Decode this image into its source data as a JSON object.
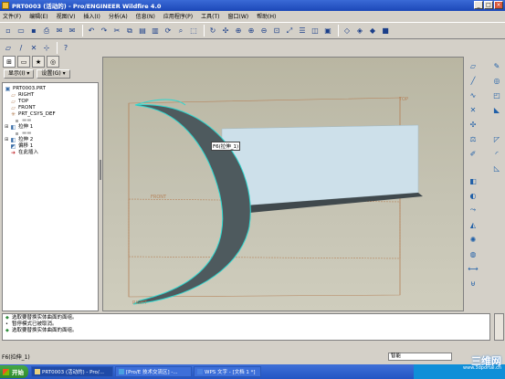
{
  "window": {
    "title": "PRT0003 (活动的) - Pro/ENGINEER Wildfire 4.0"
  },
  "menu": [
    "文件(F)",
    "编辑(E)",
    "视图(V)",
    "插入(I)",
    "分析(A)",
    "信息(N)",
    "应用程序(P)",
    "工具(T)",
    "窗口(W)",
    "帮助(H)"
  ],
  "panel": {
    "show_label": "显示(I) ▾",
    "settings_label": "设置(G) ▾"
  },
  "tree": {
    "root": "PRT0003.PRT",
    "items": [
      {
        "label": "RIGHT",
        "icon": "datum-plane-icon"
      },
      {
        "label": "TOP",
        "icon": "datum-plane-icon"
      },
      {
        "label": "FRONT",
        "icon": "datum-plane-icon"
      },
      {
        "label": "PRT_CSYS_DEF",
        "icon": "csys-icon"
      },
      {
        "label": "拉伸 1",
        "icon": "extrude-icon"
      },
      {
        "label": "拉伸 2",
        "icon": "extrude-icon"
      },
      {
        "label": "偏移 1",
        "icon": "offset-icon"
      },
      {
        "label": "在此插入",
        "icon": "insert-here-icon"
      }
    ]
  },
  "viewport": {
    "tooltip": "F6(拉伸_1)",
    "labels": {
      "top": "TOP",
      "front": "FRONT",
      "right": "RIGHT"
    }
  },
  "messages": [
    "选取要替换实体曲面的面组。",
    "暂停模式已被取消。",
    "选取要替换实体曲面的面组。"
  ],
  "status": {
    "text": "F6(拉伸_1)",
    "filter": "智能"
  },
  "taskbar": {
    "start": "开始",
    "tasks": [
      "PRT0003 (活动的) - Pro/...",
      "[Pro/E 技术交流区] -...",
      "WPS 文字 - [文档 1 *]"
    ]
  },
  "watermark": {
    "main": "三维网",
    "sub": "www.3dportal.cn"
  },
  "colors": {
    "surface_dark": "#4e5a5e",
    "surface_light": "#cde0ea",
    "edge_highlight": "#2ed8d0",
    "datum": "#b5825a"
  }
}
